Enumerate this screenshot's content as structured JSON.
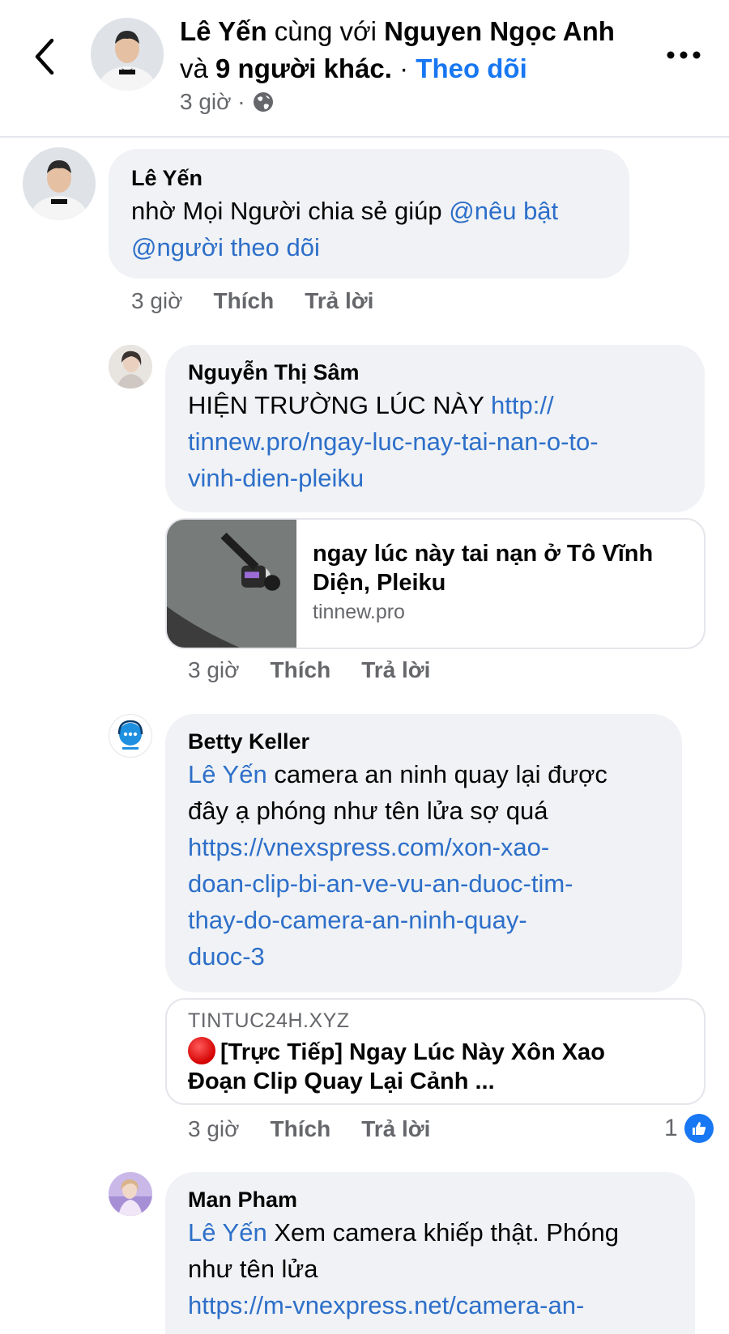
{
  "header": {
    "author": "Lê Yến",
    "with_text": " cùng với ",
    "tagged": "Nguyen Ngọc Anh",
    "and_text": " và ",
    "others": "9 người khác.",
    "separator": " · ",
    "follow_label": "Theo dõi",
    "time": "3 giờ ·",
    "privacy_icon": "globe-icon"
  },
  "comments": [
    {
      "name": "Lê Yến",
      "text": "nhờ Mọi Người chia sẻ giúp ",
      "mentions": [
        "@nêu bật",
        "@người theo dõi"
      ],
      "time": "3 giờ",
      "like_label": "Thích",
      "reply_label": "Trả lời"
    },
    {
      "name": "Nguyễn Thị Sâm",
      "text": "HIỆN TRƯỜNG LÚC NÀY ",
      "link_lines": [
        "http://",
        "tinnew.pro/ngay-luc-nay-tai-nan-o-to-",
        "vinh-dien-pleiku"
      ],
      "preview": {
        "title": "ngay lúc này tai nạn ở Tô Vĩnh Diện, Pleiku",
        "domain": "tinnew.pro"
      },
      "time": "3 giờ",
      "like_label": "Thích",
      "reply_label": "Trả lời"
    },
    {
      "name": "Betty Keller",
      "mention": "Lê Yến",
      "text_line1": " camera an ninh quay lại được",
      "text_line2": "đây ạ phóng như tên lửa sợ quá",
      "link_lines": [
        "https://vnexspress.com/xon-xao-",
        "doan-clip-bi-an-ve-vu-an-duoc-tim-",
        "thay-do-camera-an-ninh-quay-",
        "duoc-3"
      ],
      "preview": {
        "domain": "TINTUC24H.XYZ",
        "title_line1": "[Trực Tiếp] Ngay Lúc Này Xôn Xao",
        "title_line2": "Đoạn Clip Quay Lại Cảnh ..."
      },
      "time": "3 giờ",
      "like_label": "Thích",
      "reply_label": "Trả lời",
      "reaction_count": "1"
    },
    {
      "name": "Man Pham",
      "mention": "Lê Yến",
      "text_line1": " Xem camera khiếp thật. Phóng",
      "text_line2": "như tên lửa",
      "link_line1": "https://m-vnexpress.net/camera-an-"
    }
  ],
  "colors": {
    "link": "#2d6fc9",
    "accent": "#1877f2",
    "bubble": "#f0f2f5",
    "muted": "#65676b"
  }
}
